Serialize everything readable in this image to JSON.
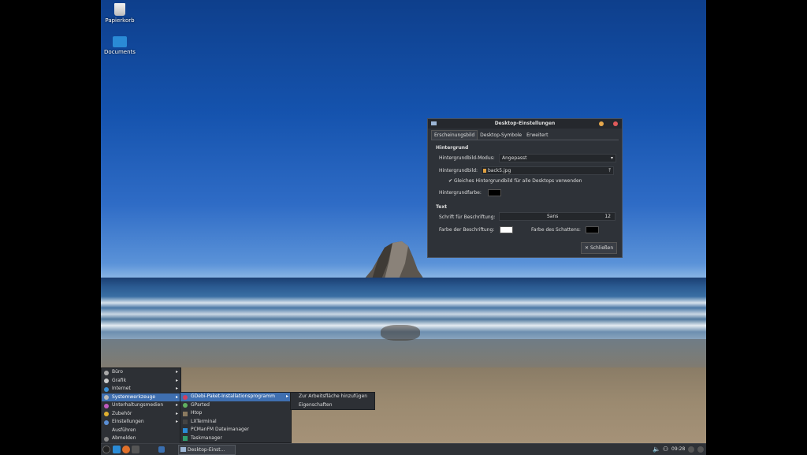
{
  "desktop": {
    "icons": [
      {
        "label": "Papierkorb",
        "icon": "trash-icon"
      },
      {
        "label": "Documents",
        "icon": "folder-icon"
      }
    ]
  },
  "dialog": {
    "title": "Desktop-Einstellungen",
    "tabs": [
      "Erscheinungsbild",
      "Desktop-Symbole",
      "Erweitert"
    ],
    "section_background": "Hintergrund",
    "mode_label": "Hintergrundbild-Modus:",
    "mode_value": "Angepasst",
    "image_label": "Hintergrundbild:",
    "image_value": "back5.jpg",
    "same_image_label": "Gleiches Hintergrundbild für alle Desktops verwenden",
    "same_image_checked": true,
    "bg_color_label": "Hintergrundfarbe:",
    "bg_color": "#000000",
    "section_text": "Text",
    "font_label": "Schrift für Beschriftung:",
    "font_name": "Sans",
    "font_size": "12",
    "label_color_label": "Farbe der Beschriftung:",
    "label_color": "#ffffff",
    "shadow_color_label": "Farbe des Schattens:",
    "shadow_color": "#000000",
    "close_button": "Schließen"
  },
  "start_menu": {
    "items": [
      {
        "label": "Büro",
        "submenu": true
      },
      {
        "label": "Grafik",
        "submenu": true
      },
      {
        "label": "Internet",
        "submenu": true
      },
      {
        "label": "Systemwerkzeuge",
        "submenu": true,
        "selected": true
      },
      {
        "label": "Unterhaltungsmedien",
        "submenu": true
      },
      {
        "label": "Zubehör",
        "submenu": true
      },
      {
        "label": "Einstellungen",
        "submenu": true
      },
      {
        "label": "Ausführen",
        "submenu": false
      },
      {
        "label": "Abmelden",
        "submenu": false
      }
    ]
  },
  "system_tools_menu": {
    "items": [
      {
        "label": "GDebi-Paket-Installationsprogramm",
        "submenu": true,
        "selected": true
      },
      {
        "label": "GParted"
      },
      {
        "label": "Htop"
      },
      {
        "label": "LXTerminal"
      },
      {
        "label": "PCManFM Dateimanager"
      },
      {
        "label": "Taskmanager"
      }
    ]
  },
  "context_menu": {
    "items": [
      "Zur Arbeitsfläche hinzufügen",
      "Eigenschaften"
    ]
  },
  "taskbar": {
    "window_button": "Desktop-Einst...",
    "clock": "09:28"
  }
}
